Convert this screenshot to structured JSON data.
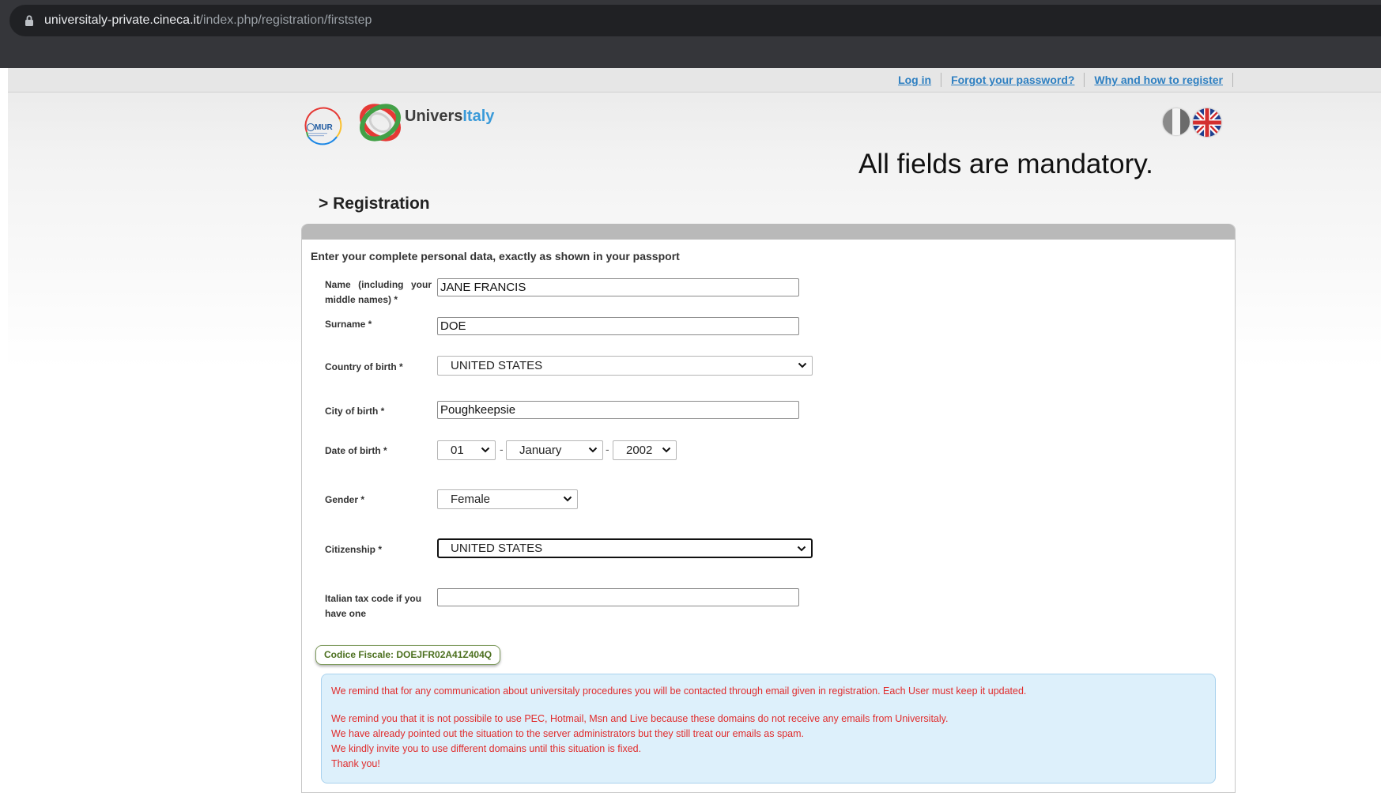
{
  "browser": {
    "url_host": "universitaly-private.cineca.it",
    "url_path": "/index.php/registration/firststep"
  },
  "topnav": {
    "login": "Log in",
    "forgot": "Forgot your password?",
    "why": "Why and how to register"
  },
  "header": {
    "mur_text": "MUR",
    "brand_part1": "Univers",
    "brand_part2": "Italy",
    "mandatory": "All fields are mandatory."
  },
  "page_title": "> Registration",
  "form": {
    "intro": "Enter your complete personal data, exactly as shown in your passport",
    "name_label": "Name (including your middle names) *",
    "name_value": "JANE FRANCIS",
    "surname_label": "Surname *",
    "surname_value": "DOE",
    "country_label": "Country of birth *",
    "country_value": "UNITED STATES",
    "city_label": "City of birth *",
    "city_value": "Poughkeepsie",
    "dob_label": "Date of birth *",
    "dob_day": "01",
    "dob_month": "January",
    "dob_year": "2002",
    "dob_sep": "-",
    "gender_label": "Gender *",
    "gender_value": "Female",
    "citizenship_label": "Citizenship *",
    "citizenship_value": "UNITED STATES",
    "taxcode_label": "Italian tax code if you have one",
    "taxcode_value": "",
    "codice_fiscale": "Codice Fiscale:  DOEJFR02A41Z404Q"
  },
  "notice": {
    "line1": "We remind that for any communication about universitaly procedures you will be contacted through email given in registration. Each User must keep it updated.",
    "line2": "We remind you that it is not possibile to use PEC, Hotmail, Msn and Live because these domains do not receive any emails from Universitaly.",
    "line3": "We have already pointed out the situation to the server administrators but they still treat our emails as spam.",
    "line4": "We kindly invite you to use different domains until this situation is fixed.",
    "line5": "Thank you!"
  },
  "colors": {
    "link": "#2d7fc1",
    "notice_text": "#e02c2c",
    "notice_bg": "#ddf0fb",
    "brand_blue": "#3a9ad9"
  }
}
